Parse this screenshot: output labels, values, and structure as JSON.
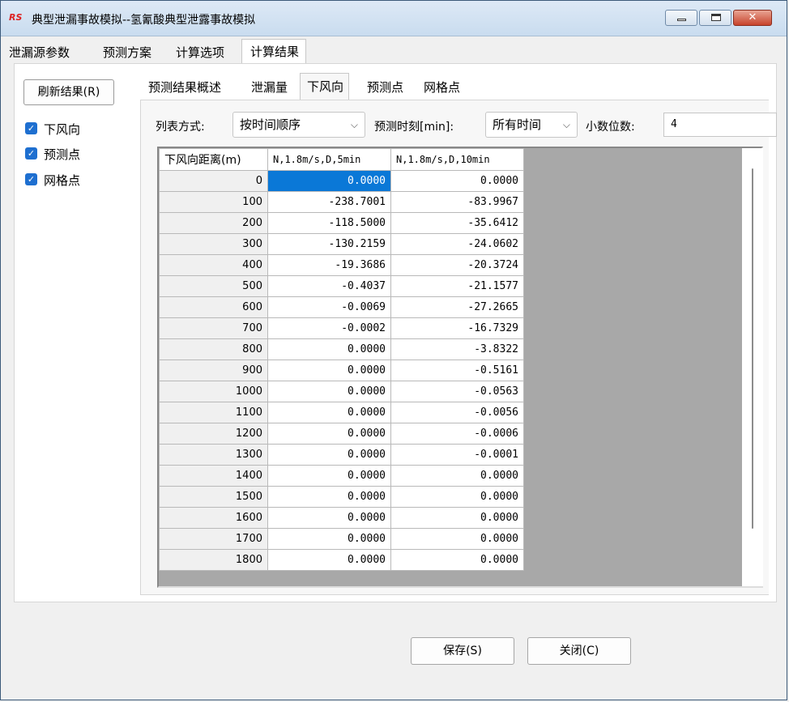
{
  "window": {
    "title": "典型泄漏事故模拟--氢氰酸典型泄露事故模拟",
    "icon_text": "RS",
    "close_glyph": "✕"
  },
  "main_tabs": [
    {
      "label": "泄漏源参数"
    },
    {
      "label": "预测方案"
    },
    {
      "label": "计算选项"
    },
    {
      "label": "计算结果",
      "active": true
    }
  ],
  "sidebar": {
    "refresh_label": "刷新结果(R)",
    "checks": [
      {
        "label": "下风向",
        "checked": true
      },
      {
        "label": "预测点",
        "checked": true
      },
      {
        "label": "网格点",
        "checked": true
      }
    ]
  },
  "sub_tabs": [
    {
      "label": "预测结果概述"
    },
    {
      "label": "泄漏量"
    },
    {
      "label": "下风向",
      "active": true
    },
    {
      "label": "预测点"
    },
    {
      "label": "网格点"
    }
  ],
  "options": {
    "list_mode_label": "列表方式:",
    "list_mode_value": "按时间顺序",
    "time_label": "预测时刻[min]:",
    "time_value": "所有时间",
    "digits_label": "小数位数:",
    "digits_value": "4"
  },
  "grid": {
    "headers": [
      "下风向距离(m)",
      "N,1.8m/s,D,5min",
      "N,1.8m/s,D,10min"
    ],
    "rows": [
      [
        "0",
        "0.0000",
        "0.0000"
      ],
      [
        "100",
        "-238.7001",
        "-83.9967"
      ],
      [
        "200",
        "-118.5000",
        "-35.6412"
      ],
      [
        "300",
        "-130.2159",
        "-24.0602"
      ],
      [
        "400",
        "-19.3686",
        "-20.3724"
      ],
      [
        "500",
        "-0.4037",
        "-21.1577"
      ],
      [
        "600",
        "-0.0069",
        "-27.2665"
      ],
      [
        "700",
        "-0.0002",
        "-16.7329"
      ],
      [
        "800",
        "0.0000",
        "-3.8322"
      ],
      [
        "900",
        "0.0000",
        "-0.5161"
      ],
      [
        "1000",
        "0.0000",
        "-0.0563"
      ],
      [
        "1100",
        "0.0000",
        "-0.0056"
      ],
      [
        "1200",
        "0.0000",
        "-0.0006"
      ],
      [
        "1300",
        "0.0000",
        "-0.0001"
      ],
      [
        "1400",
        "0.0000",
        "0.0000"
      ],
      [
        "1500",
        "0.0000",
        "0.0000"
      ],
      [
        "1600",
        "0.0000",
        "0.0000"
      ],
      [
        "1700",
        "0.0000",
        "0.0000"
      ],
      [
        "1800",
        "0.0000",
        "0.0000"
      ]
    ]
  },
  "buttons": {
    "save_label": "保存(S)",
    "close_label": "关闭(C)"
  },
  "icons": {
    "combo_arrow": "⌵",
    "check": "✓"
  }
}
